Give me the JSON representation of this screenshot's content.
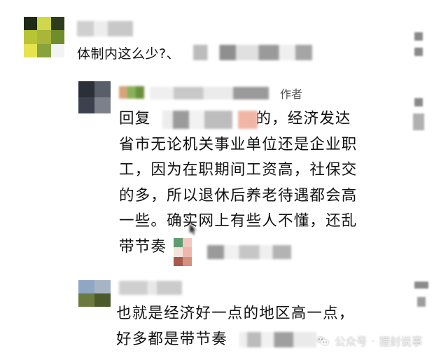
{
  "comments": [
    {
      "text": "体制内这么少?、"
    },
    {
      "author_tag": "作者",
      "lines": [
        "回复",
        "省市无论机关事业单位还是企业职",
        "工，因为在职期间工资高，社保交",
        "的多，所以退休后养老待遇都会高",
        "一些。确实网上有些人不懂，还乱",
        "带节奏"
      ],
      "line1_tail": "的，经济发达"
    },
    {
      "lines": [
        "也就是经济好一点的地区高一点，",
        "好多都是带节奏"
      ]
    }
  ],
  "watermark": {
    "channel": "公众号",
    "name": "狸封说事"
  },
  "colors": {
    "text": "#111111",
    "author_tag": "#555555",
    "mosaic_gray": "#8a8a8a"
  },
  "icons": [
    "wechat-icon",
    "avatar",
    "emoji",
    "mouse-cursor-icon"
  ]
}
